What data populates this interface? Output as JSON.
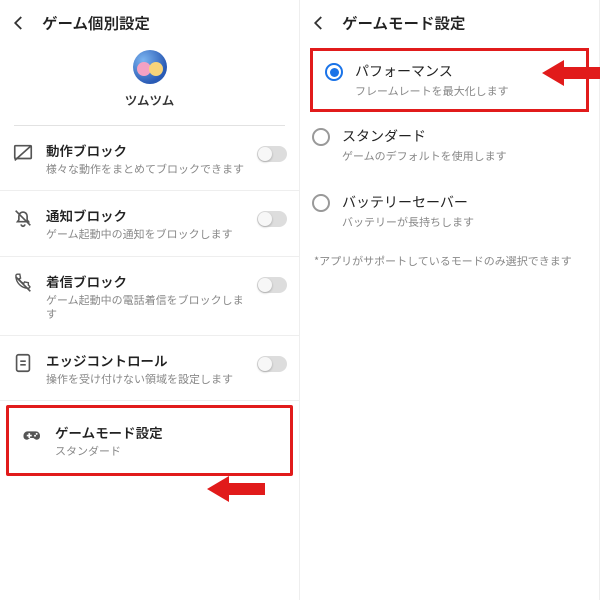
{
  "left": {
    "header_title": "ゲーム個別設定",
    "game_name": "ツムツム",
    "rows": [
      {
        "title": "動作ブロック",
        "sub": "様々な動作をまとめてブロックできます",
        "toggle": false
      },
      {
        "title": "通知ブロック",
        "sub": "ゲーム起動中の通知をブロックします",
        "toggle": false
      },
      {
        "title": "着信ブロック",
        "sub": "ゲーム起動中の電話着信をブロックします",
        "toggle": false
      },
      {
        "title": "エッジコントロール",
        "sub": "操作を受け付けない領域を設定します",
        "toggle": false
      },
      {
        "title": "ゲームモード設定",
        "sub": "スタンダード"
      }
    ]
  },
  "right": {
    "header_title": "ゲームモード設定",
    "options": [
      {
        "title": "パフォーマンス",
        "sub": "フレームレートを最大化します",
        "checked": true
      },
      {
        "title": "スタンダード",
        "sub": "ゲームのデフォルトを使用します",
        "checked": false
      },
      {
        "title": "バッテリーセーバー",
        "sub": "バッテリーが長持ちします",
        "checked": false
      }
    ],
    "footnote": "*アプリがサポートしているモードのみ選択できます"
  }
}
